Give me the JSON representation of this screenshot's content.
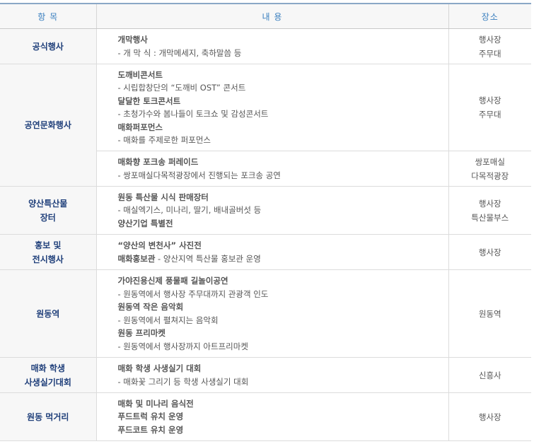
{
  "headers": {
    "item": "항 목",
    "content": "내 용",
    "place": "장소"
  },
  "rows": {
    "r1": {
      "cat": "공식행사",
      "b1": "개막행사",
      "d1": "- 개 막 식 : 개막메세지, 축하말씀 등",
      "p1": "행사장",
      "p2": "주무대"
    },
    "r2": {
      "cat": "공연문화행사",
      "b1": "도깨비콘서트",
      "d1": "- 시립합창단의 “도깨비 OST” 콘서트",
      "b2": "달달한 토크콘서트",
      "d2": "- 초청가수와 봄나들이 토크쇼 및 감성콘서트",
      "b3": "매화퍼포먼스",
      "d3": "- 매화를 주제로한 퍼포먼스",
      "p1": "행사장",
      "p2": "주무대"
    },
    "r2b": {
      "b1": "매화향 포크송 퍼레이드",
      "d1": "- 쌍포매실다목적광장에서 진행되는 포크송 공연",
      "p1": "쌍포매실",
      "p2": "다목적광장"
    },
    "r3": {
      "cat1": "양산특산물",
      "cat2": "장터",
      "b1": "원동 특산물 시식 판매장터",
      "d1": "- 매실엑기스, 미나리, 딸기, 배내골버섯 등",
      "b2": "양산기업 특별전",
      "p1": "행사장",
      "p2": "특산물부스"
    },
    "r4": {
      "cat1": "홍보 및",
      "cat2": "전시행사",
      "b1": "“양산의 변천사” 사진전",
      "b2": "매화홍보관",
      "d2": " - 양산지역 특산물 홍보관 운영",
      "p1": "행사장"
    },
    "r5": {
      "cat": "원동역",
      "b1": "가야진용신제 풍물패 길놀이공연",
      "d1": "- 원동역에서 행사장 주무대까지 관광객 인도",
      "b2": "원동역 작은 음악회",
      "d2": "- 원동역에서 펼쳐지는 음악회",
      "b3": "원동 프리마켓",
      "d3": "- 원동역에서 행사장까지 아트프리마켓",
      "p1": "원동역"
    },
    "r6": {
      "cat1": "매화 학생",
      "cat2": "사생실기대회",
      "b1": "매화 학생 사생실기 대회",
      "d1": "- 매화꽃 그리기 등 학생 사생실기 대회",
      "p1": "신흥사"
    },
    "r7": {
      "cat": "원동 먹거리",
      "b1": "매화 및 미나리 음식전",
      "b2": "푸드트럭 유치 운영",
      "b3": "푸드코트 유치 운영",
      "p1": "행사장"
    }
  }
}
